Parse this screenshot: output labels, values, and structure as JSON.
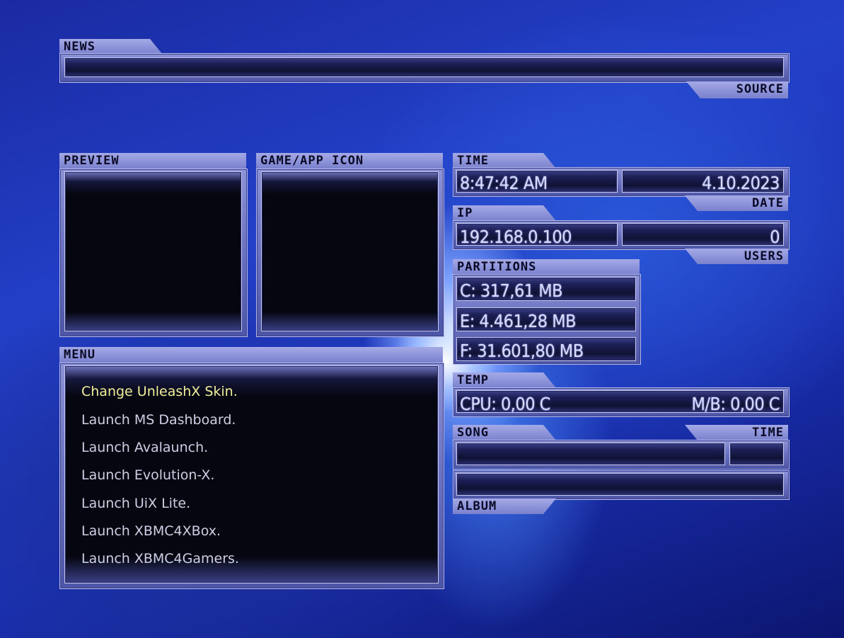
{
  "news": {
    "title": "NEWS",
    "source_label": "SOURCE"
  },
  "preview": {
    "title": "PREVIEW"
  },
  "game_icon": {
    "title": "GAME/APP ICON"
  },
  "time_section": {
    "title": "TIME",
    "time": "8:47:42 AM",
    "date": "4.10.2023",
    "date_label": "DATE"
  },
  "ip_section": {
    "title": "IP",
    "ip": "192.168.0.100",
    "users": "0",
    "users_label": "USERS"
  },
  "partitions": {
    "title": "PARTITIONS",
    "items": [
      "C: 317,61 MB",
      "E: 4.461,28 MB",
      "F: 31.601,80 MB"
    ]
  },
  "temp": {
    "title": "TEMP",
    "cpu": "CPU: 0,00 C",
    "mb": "M/B: 0,00 C"
  },
  "song": {
    "title": "SONG",
    "time_label": "TIME",
    "album_label": "ALBUM"
  },
  "menu": {
    "title": "MENU",
    "items": [
      "Change UnleashX Skin.",
      "Launch MS Dashboard.",
      "Launch Avalaunch.",
      "Launch Evolution-X.",
      "Launch UiX Lite.",
      "Launch XBMC4XBox.",
      "Launch XBMC4Gamers."
    ],
    "selected_index": 0
  },
  "colors": {
    "selected_text": "#f1ee9a",
    "menu_text": "#cdd0e4",
    "panel": "#7a81cd"
  }
}
